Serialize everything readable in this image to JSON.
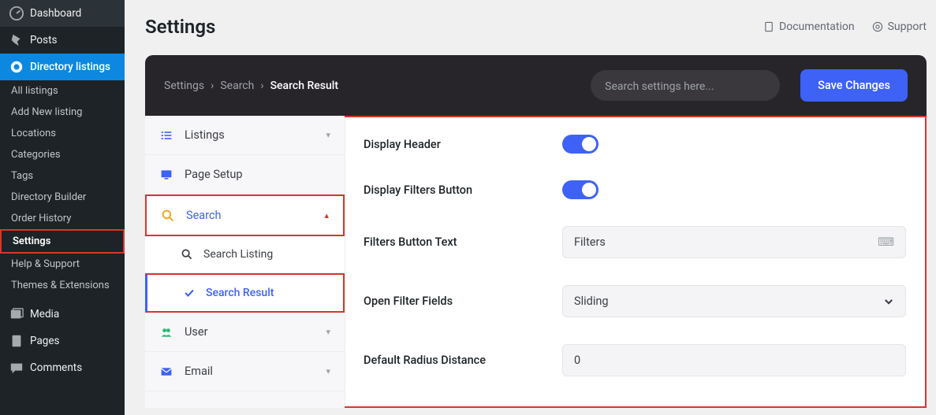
{
  "wp_menu": {
    "dashboard": "Dashboard",
    "posts": "Posts",
    "directory": "Directory listings",
    "subs": {
      "all_listings": "All listings",
      "add_new": "Add New listing",
      "locations": "Locations",
      "categories": "Categories",
      "tags": "Tags",
      "builder": "Directory Builder",
      "order_history": "Order History",
      "settings": "Settings",
      "help": "Help & Support",
      "themes": "Themes & Extensions"
    },
    "media": "Media",
    "pages": "Pages",
    "comments": "Comments"
  },
  "page": {
    "title": "Settings",
    "doc": "Documentation",
    "support": "Support"
  },
  "crumbs": {
    "root": "Settings",
    "mid": "Search",
    "leaf": "Search Result"
  },
  "search_placeholder": "Search settings here...",
  "save_label": "Save Changes",
  "sections": {
    "listings": "Listings",
    "page_setup": "Page Setup",
    "search": "Search",
    "search_listing": "Search Listing",
    "search_result": "Search Result",
    "user": "User",
    "email": "Email"
  },
  "fields": {
    "display_header": "Display Header",
    "display_filters_btn": "Display Filters Button",
    "filters_btn_text": {
      "label": "Filters Button Text",
      "value": "Filters"
    },
    "open_filter_fields": {
      "label": "Open Filter Fields",
      "value": "Sliding"
    },
    "default_radius": {
      "label": "Default Radius Distance",
      "value": "0"
    }
  }
}
